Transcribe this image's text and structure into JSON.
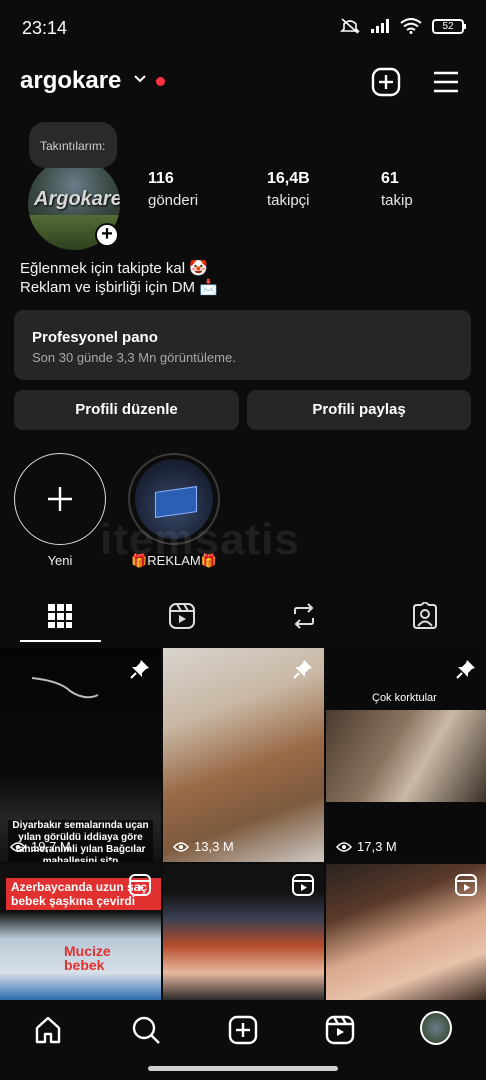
{
  "status": {
    "time": "23:14",
    "battery": "52"
  },
  "header": {
    "username": "argokare"
  },
  "profile": {
    "note": "Takıntılarım:",
    "avatar_text": "Argokare",
    "stats": [
      {
        "value": "116",
        "label": "gönderi"
      },
      {
        "value": "16,4B",
        "label": "takipçi"
      },
      {
        "value": "61",
        "label": "takip"
      }
    ],
    "bio": [
      "Eğlenmek için takipte kal 🤡",
      "Reklam ve işbirliği için DM 📩"
    ]
  },
  "pro_dashboard": {
    "title": "Profesyonel pano",
    "subtitle": "Son 30 günde 3,3 Mn görüntüleme."
  },
  "buttons": {
    "edit": "Profili düzenle",
    "share": "Profili paylaş"
  },
  "highlights": [
    {
      "label": "Yeni"
    },
    {
      "label": "🎁REKLAM🎁"
    }
  ],
  "watermark": "itemsatis",
  "posts": [
    {
      "caption": "Diyarbakır semalarında uçan yılan görüldü iddiaya göre tahmeranimli yılan Bağcılar mahallesini si*p süpürecekmiş",
      "views": "19,7 M",
      "pinned": true
    },
    {
      "views": "13,3 M",
      "pinned": true
    },
    {
      "caption": "Çok korktular",
      "views": "17,3 M",
      "pinned": true
    },
    {
      "caption": "Azerbaycanda uzun saç bebek şaşkına çevirdi",
      "overlay": "Mucize bebek",
      "reel": true
    },
    {
      "reel": true
    },
    {
      "reel": true
    }
  ]
}
